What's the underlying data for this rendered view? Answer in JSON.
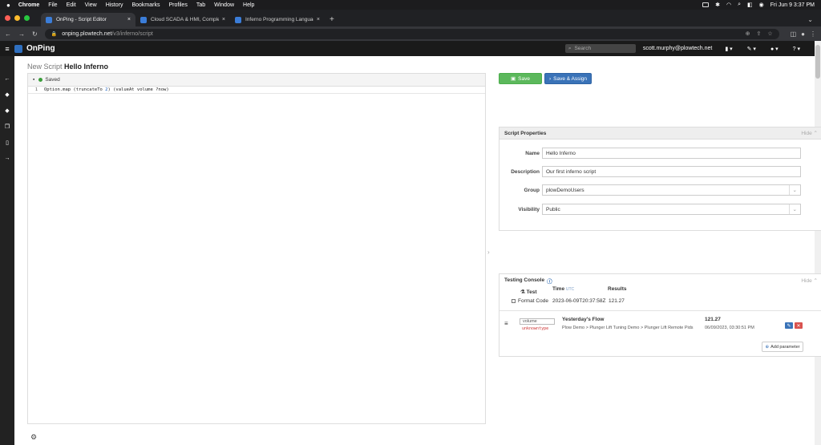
{
  "menubar": {
    "apple": "",
    "items": [
      "Chrome",
      "File",
      "Edit",
      "View",
      "History",
      "Bookmarks",
      "Profiles",
      "Tab",
      "Window",
      "Help"
    ],
    "datetime": "Fri Jun 9  3:37 PM"
  },
  "tabs": [
    {
      "title": "OnPing - Script Editor",
      "close": "×"
    },
    {
      "title": "Cloud SCADA & HMI, Complete",
      "close": "×"
    },
    {
      "title": "Inferno Programming Language",
      "close": "×"
    }
  ],
  "newtab": "+",
  "addressbar": {
    "host": "onping.plowtech.net",
    "path": "/v3/inferno/script"
  },
  "app": {
    "brand": "OnPing",
    "search_placeholder": "Search",
    "user": "scott.murphy@plowtech.net"
  },
  "page": {
    "title_prefix": "New Script",
    "title_name": "Hello Inferno"
  },
  "editor": {
    "status": "Saved",
    "line_no": "1",
    "code_a": "Option.map (truncateTo ",
    "code_num": "2",
    "code_b": ") (valueAt volume ?now)"
  },
  "buttons": {
    "save": "Save",
    "save_assign": "Save & Assign"
  },
  "properties": {
    "heading": "Script Properties",
    "hide": "Hide",
    "name_label": "Name",
    "name_value": "Hello Inferno",
    "description_label": "Description",
    "description_value": "Our first inferno script",
    "group_label": "Group",
    "group_value": "plowDemoUsers",
    "visibility_label": "Visibility",
    "visibility_value": "Public"
  },
  "console": {
    "heading": "Testing Console",
    "hide": "Hide",
    "test_label": "Test",
    "format_code_label": "Format Code",
    "time_header": "Time",
    "time_unit": "UTC",
    "results_header": "Results",
    "time_value": "2023-06-09T20:37:58Z",
    "result_value": "121.27",
    "param_var": "volume",
    "param_type": "unknowntype",
    "param_title": "Yesterday's Flow",
    "param_path": "Plow Demo  >  Plunger Lift Tuning Demo  >  Plunger Lift Remote Pids",
    "param_value": "121.27",
    "param_time": "06/09/2023, 03:30:51 PM",
    "add_parameter": "Add parameter"
  },
  "colors": {
    "save_green": "#5cb85c",
    "assign_blue": "#3a73b8",
    "app_header": "#1a1a1a"
  }
}
